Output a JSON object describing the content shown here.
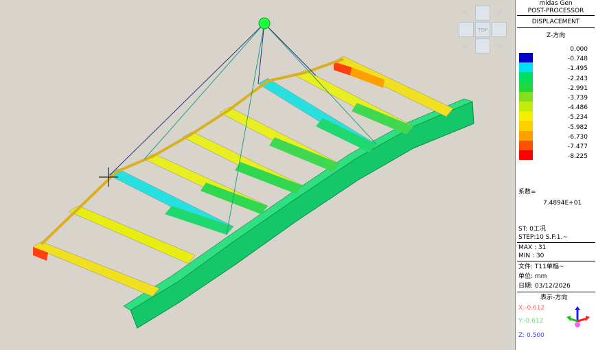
{
  "panel": {
    "app_name": "midas Gen",
    "processor": "POST-PROCESSOR",
    "result_type": "DISPLACEMENT",
    "component": "Z-方向",
    "legend": [
      {
        "value": "0.000",
        "color": "#0000c8"
      },
      {
        "value": "-0.748",
        "color": "#00e0f0"
      },
      {
        "value": "-1.495",
        "color": "#00e8a0"
      },
      {
        "value": "-2.243",
        "color": "#00e060"
      },
      {
        "value": "-2.991",
        "color": "#20d840"
      },
      {
        "value": "-3.739",
        "color": "#80e020"
      },
      {
        "value": "-4.486",
        "color": "#c0ec10"
      },
      {
        "value": "-5.234",
        "color": "#f0f000"
      },
      {
        "value": "-5.982",
        "color": "#ffd000"
      },
      {
        "value": "-6.730",
        "color": "#ffa000"
      },
      {
        "value": "-7.477",
        "color": "#ff5000"
      },
      {
        "value": "-8.225",
        "color": "#ff0000"
      }
    ],
    "factor_label": "系数=",
    "factor_value": "7.4894E+01",
    "st": "ST: 0工况",
    "step": "STEP:10 S.F:1.~",
    "max": "MAX : 31",
    "min": "MIN : 30",
    "file": "文件: T11单榀~",
    "unit": "单位: mm",
    "date": "日期: 03/12/2026",
    "view_dir": "表示-方向",
    "axis_x": "X:-0.612",
    "axis_y": "Y:-0.612",
    "axis_z": "Z:  0.500"
  },
  "viewcube": {
    "label": "TOP"
  },
  "colors": {
    "x_axis": "#ff6060",
    "y_axis": "#60ff60",
    "z_axis": "#4040ff"
  }
}
